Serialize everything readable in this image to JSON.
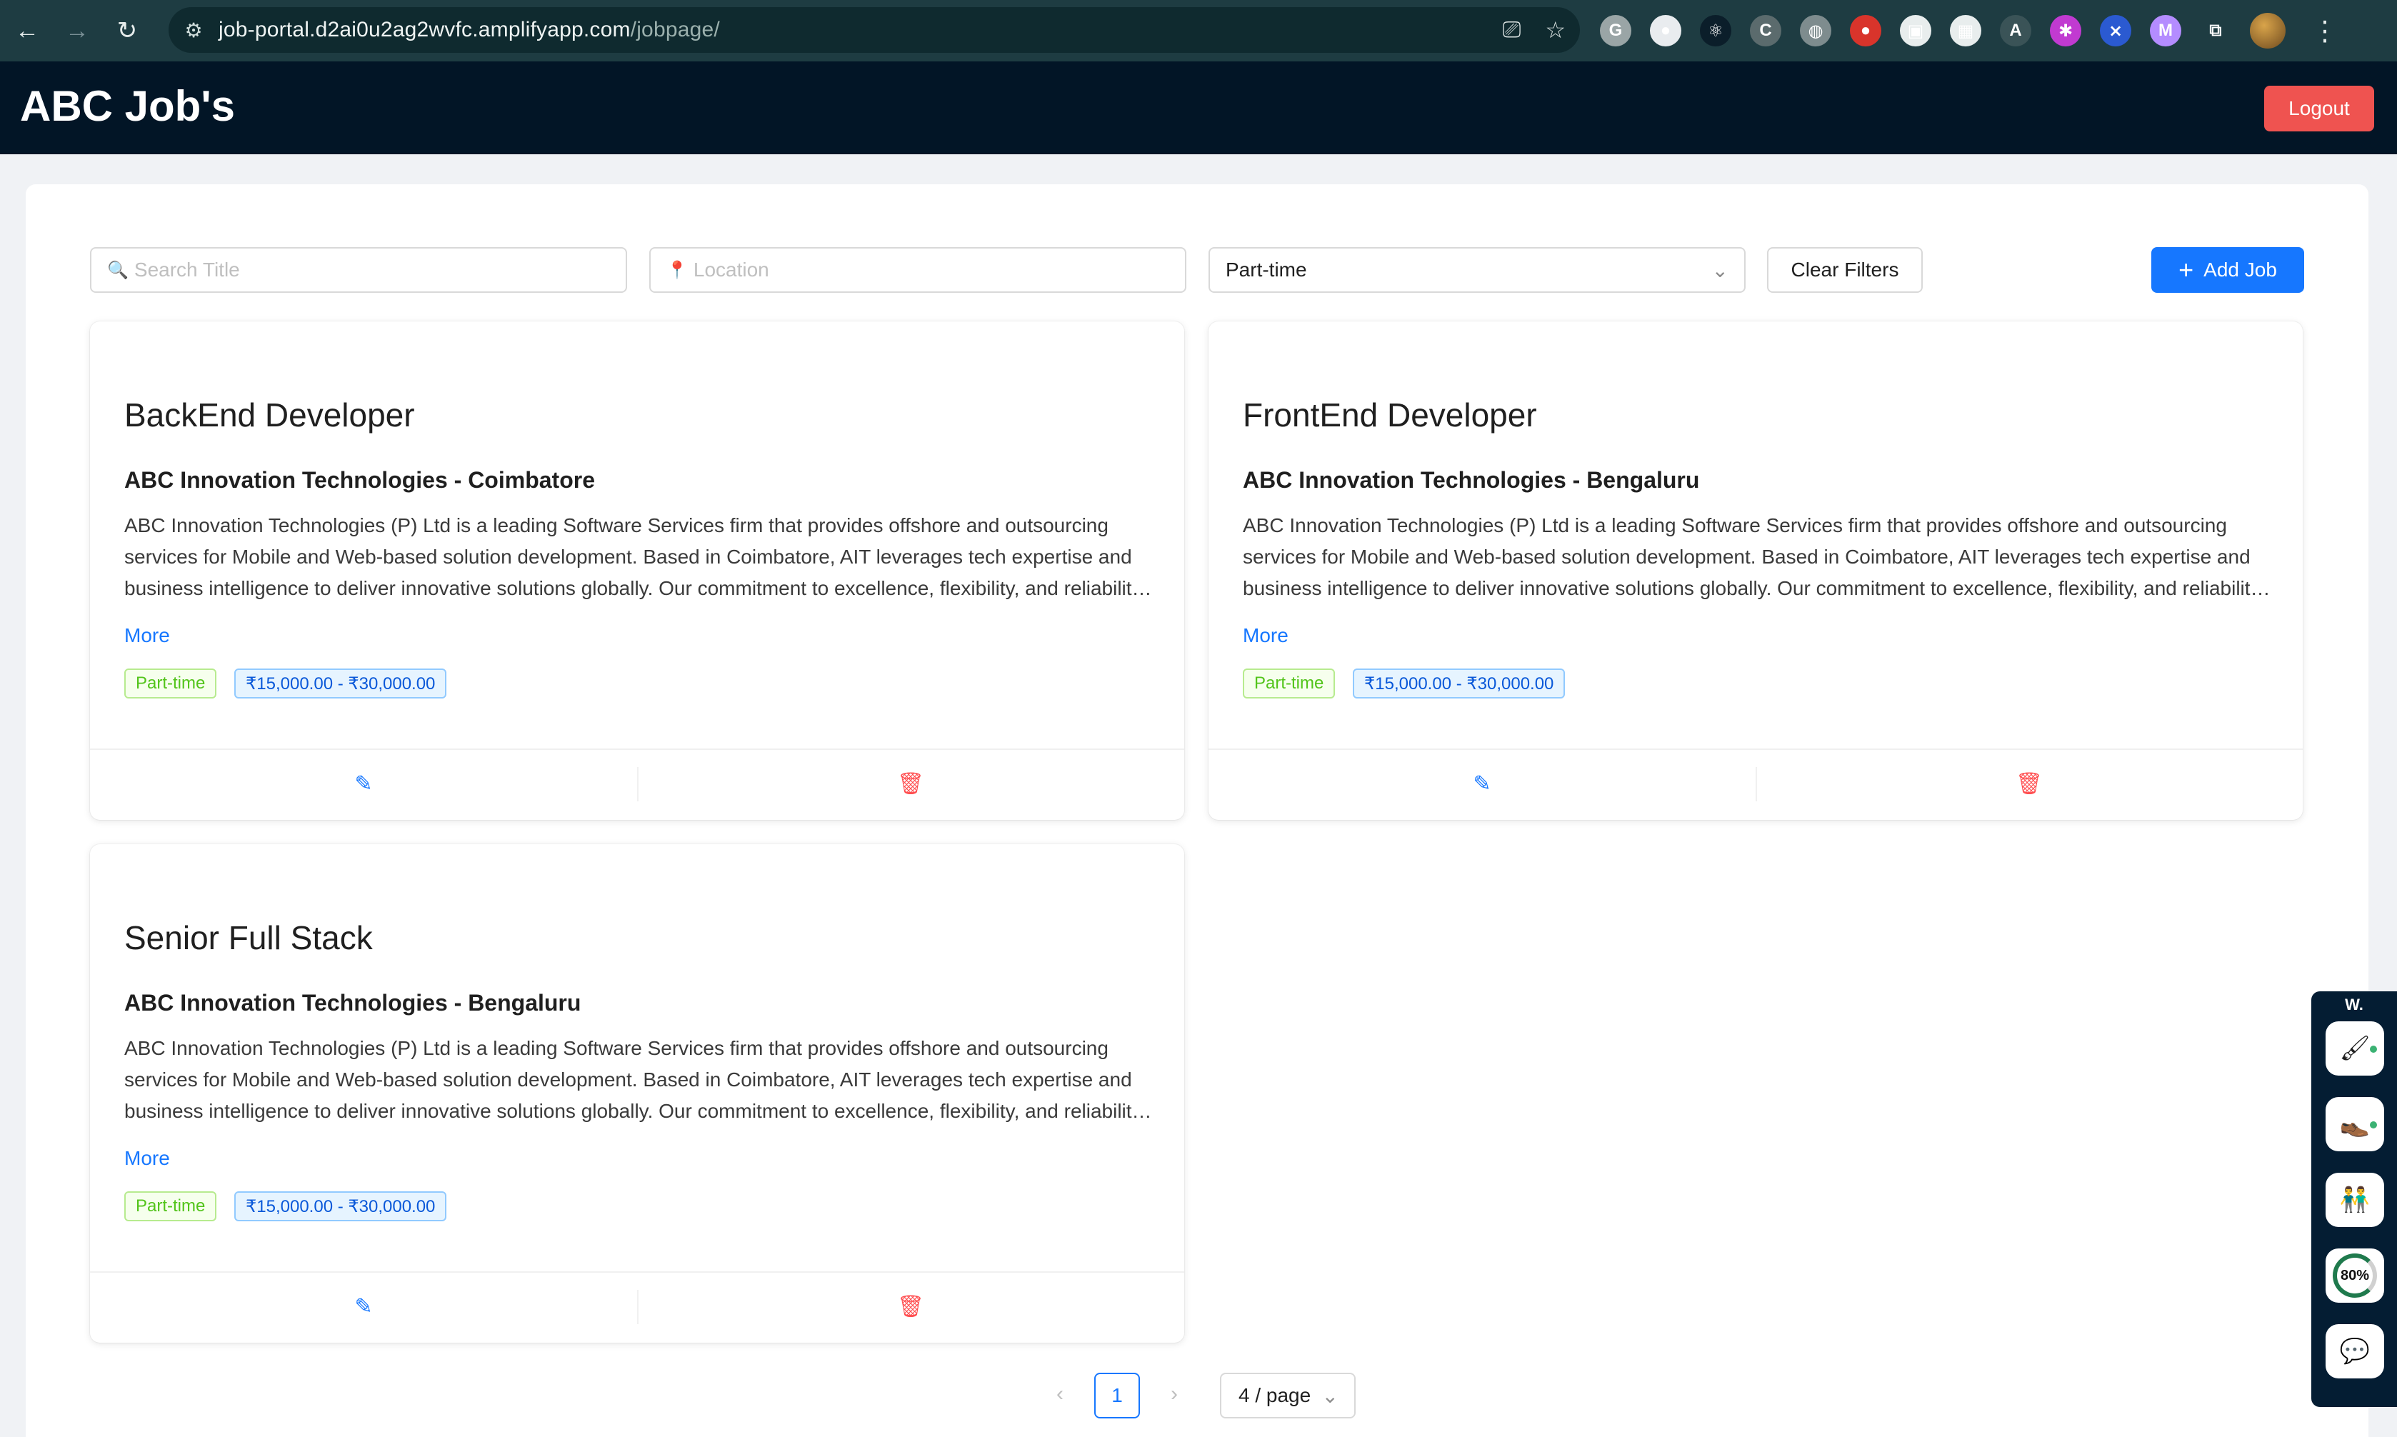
{
  "browser": {
    "url_host": "job-portal.d2ai0u2ag2wvfc.amplifyapp.com",
    "url_path": "/jobpage/",
    "back_icon": "arrow-left-icon",
    "forward_icon": "arrow-right-icon",
    "reload_icon": "reload-icon",
    "extensions": [
      {
        "name": "grammarly-icon",
        "color": "#9aa5a6",
        "glyph": "G"
      },
      {
        "name": "extension-circle-icon",
        "color": "#e9ecef",
        "glyph": "●"
      },
      {
        "name": "react-devtools-icon",
        "color": "#0b1e2a",
        "glyph": "⚛"
      },
      {
        "name": "extension-c-icon",
        "color": "#5b6b6d",
        "glyph": "C"
      },
      {
        "name": "globe-icon",
        "color": "#7e8c8e",
        "glyph": "◍"
      },
      {
        "name": "red-shield-icon",
        "color": "#d9342b",
        "glyph": "●"
      },
      {
        "name": "window-extension-icon",
        "color": "#e8eded",
        "glyph": "▣"
      },
      {
        "name": "qr-code-icon",
        "color": "#e8eded",
        "glyph": "▦"
      },
      {
        "name": "a-circle-icon",
        "color": "#3a5357",
        "glyph": "A"
      },
      {
        "name": "gear-pink-icon",
        "color": "#c13ad1",
        "glyph": "✱"
      },
      {
        "name": "blue-stitch-icon",
        "color": "#2b5ad1",
        "glyph": "⨯"
      },
      {
        "name": "mail-extension-icon",
        "color": "#b48cff",
        "glyph": "M"
      },
      {
        "name": "puzzle-icon",
        "color": "#1e3c42",
        "glyph": "⧉"
      }
    ]
  },
  "app": {
    "title": "ABC Job's",
    "logout_label": "Logout"
  },
  "filters": {
    "search_placeholder": "Search Title",
    "location_placeholder": "Location",
    "job_type_value": "Part-time",
    "clear_label": "Clear Filters",
    "add_label": "Add Job"
  },
  "jobs": [
    {
      "title": "BackEnd Developer",
      "company_location": "ABC Innovation Technologies - Coimbatore",
      "description": "ABC Innovation Technologies (P) Ltd is a leading Software Services firm that provides offshore and outsourcing services for Mobile and Web-based solution development. Based in Coimbatore, AIT leverages tech expertise and business intelligence to deliver innovative solutions globally. Our commitment to excellence, flexibility, and reliability drives every project we take on.",
      "more_label": "More",
      "type_tag": "Part-time",
      "salary_tag": "₹15,000.00 - ₹30,000.00"
    },
    {
      "title": "FrontEnd Developer",
      "company_location": "ABC Innovation Technologies - Bengaluru",
      "description": "ABC Innovation Technologies (P) Ltd is a leading Software Services firm that provides offshore and outsourcing services for Mobile and Web-based solution development. Based in Coimbatore, AIT leverages tech expertise and business intelligence to deliver innovative solutions globally. Our commitment to excellence, flexibility, and reliability drives every project we take on.",
      "more_label": "More",
      "type_tag": "Part-time",
      "salary_tag": "₹15,000.00 - ₹30,000.00"
    },
    {
      "title": "Senior Full Stack",
      "company_location": "ABC Innovation Technologies - Bengaluru",
      "description": "ABC Innovation Technologies (P) Ltd is a leading Software Services firm that provides offshore and outsourcing services for Mobile and Web-based solution development. Based in Coimbatore, AIT leverages tech expertise and business intelligence to deliver innovative solutions globally. Our commitment to excellence, flexibility, and reliability drives every project we take on.",
      "more_label": "More",
      "type_tag": "Part-time",
      "salary_tag": "₹15,000.00 - ₹30,000.00"
    }
  ],
  "pagination": {
    "current_page": "1",
    "page_size_label": "4 / page"
  },
  "widget": {
    "label": "W.",
    "progress": "80%"
  },
  "colors": {
    "header_bg": "#021526",
    "logout_bg": "#ef5350",
    "primary": "#1677ff",
    "danger": "#ff4d4f",
    "tag_green": "#52c41a",
    "tag_blue": "#0958d9"
  }
}
